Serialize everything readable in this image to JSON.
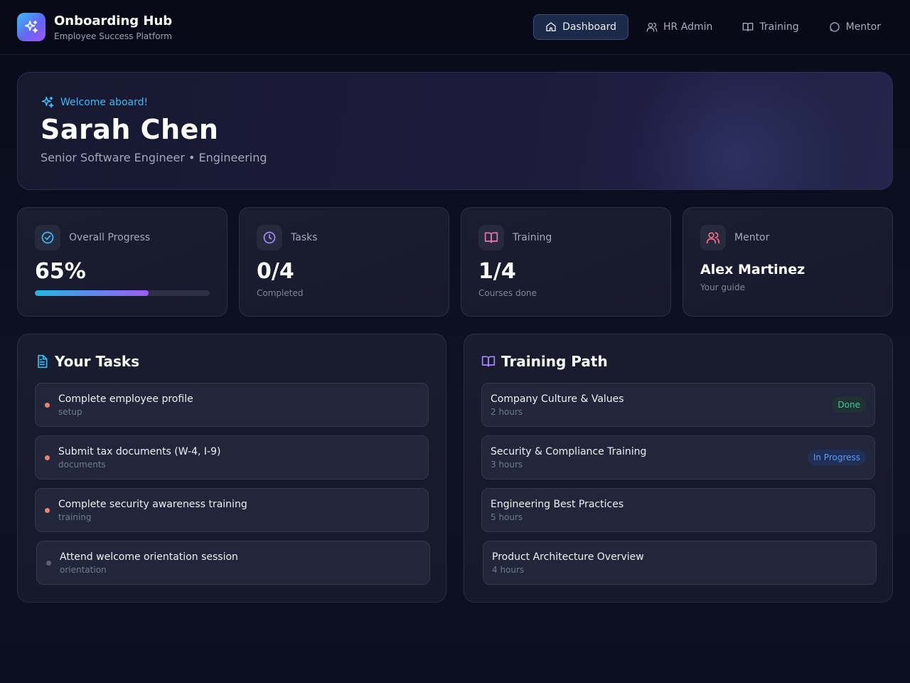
{
  "app": {
    "title": "Onboarding Hub",
    "subtitle": "Employee Success Platform"
  },
  "nav": {
    "items": [
      {
        "label": "Dashboard",
        "icon": "home-icon",
        "active": true
      },
      {
        "label": "HR Admin",
        "icon": "users-icon",
        "active": false
      },
      {
        "label": "Training",
        "icon": "book-icon",
        "active": false
      },
      {
        "label": "Mentor",
        "icon": "chat-icon",
        "active": false
      }
    ]
  },
  "hero": {
    "welcome": "Welcome aboard!",
    "name": "Sarah Chen",
    "role": "Senior Software Engineer • Engineering"
  },
  "stats": {
    "progress": {
      "label": "Overall Progress",
      "value": "65%",
      "fraction": 0.65
    },
    "tasks": {
      "label": "Tasks",
      "value": "0/4",
      "sub": "Completed"
    },
    "training": {
      "label": "Training",
      "value": "1/4",
      "sub": "Courses done"
    },
    "mentor": {
      "label": "Mentor",
      "value": "Alex Martinez",
      "sub": "Your guide"
    }
  },
  "tasks": {
    "title": "Your Tasks",
    "items": [
      {
        "title": "Complete employee profile",
        "category": "setup",
        "status": "pending"
      },
      {
        "title": "Submit tax documents (W-4, I-9)",
        "category": "documents",
        "status": "pending"
      },
      {
        "title": "Complete security awareness training",
        "category": "training",
        "status": "pending"
      },
      {
        "title": "Attend welcome orientation session",
        "category": "orientation",
        "status": "inactive"
      }
    ]
  },
  "training": {
    "title": "Training Path",
    "items": [
      {
        "title": "Company Culture & Values",
        "duration": "2 hours",
        "badge": "Done"
      },
      {
        "title": "Security & Compliance Training",
        "duration": "3 hours",
        "badge": "In Progress"
      },
      {
        "title": "Engineering Best Practices",
        "duration": "5 hours",
        "badge": ""
      },
      {
        "title": "Product Architecture Overview",
        "duration": "4 hours",
        "badge": ""
      }
    ]
  },
  "colors": {
    "accent_cyan": "#38bdf8",
    "accent_purple": "#a855f7",
    "pending_dot": "#f07f6e",
    "done_badge": "#46c3a8",
    "progress_badge": "#5c9bf0"
  }
}
